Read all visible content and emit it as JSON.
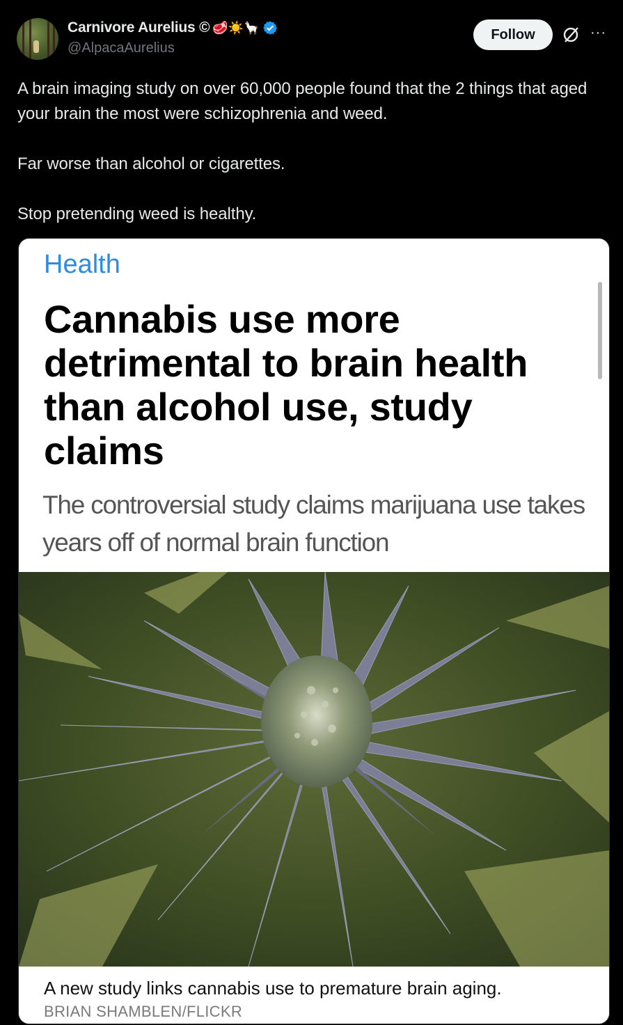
{
  "post": {
    "author": {
      "display_name": "Carnivore Aurelius ©",
      "name_emojis": "🥩☀️🦙",
      "handle": "@AlpacaAurelius",
      "verified": true
    },
    "follow_label": "Follow",
    "more_label": "···",
    "text": {
      "para1": "A brain imaging study on over 60,000 people found that the 2 things that aged your brain the most were schizophrenia and weed.",
      "para2": "Far worse than alcohol or cigarettes.",
      "para3": "Stop pretending weed is healthy."
    }
  },
  "article": {
    "section": "Health",
    "headline": "Cannabis use more detrimental to brain health than alcohol use, study claims",
    "subhead": "The controversial study claims marijuana use takes years off of normal brain function",
    "image_caption": "A new study links cannabis use to premature brain aging.",
    "image_credit": "BRIAN SHAMBLEN/FLICKR"
  },
  "colors": {
    "background": "#000000",
    "text": "#e7e9ea",
    "muted": "#71767b",
    "verified_blue": "#1d9bf0",
    "section_blue": "#2f8be0"
  },
  "icons": [
    "verified-badge-icon",
    "grok-icon",
    "more-icon"
  ]
}
